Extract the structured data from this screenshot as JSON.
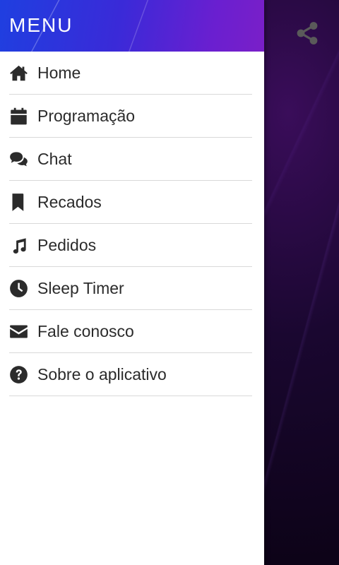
{
  "drawer": {
    "title": "MENU",
    "items": [
      {
        "label": "Home",
        "icon": "home-icon"
      },
      {
        "label": "Programação",
        "icon": "calendar-icon"
      },
      {
        "label": "Chat",
        "icon": "chat-icon"
      },
      {
        "label": "Recados",
        "icon": "bookmark-icon"
      },
      {
        "label": "Pedidos",
        "icon": "music-icon"
      },
      {
        "label": "Sleep Timer",
        "icon": "clock-icon"
      },
      {
        "label": "Fale conosco",
        "icon": "envelope-icon"
      },
      {
        "label": "Sobre o aplicativo",
        "icon": "question-circle-icon"
      }
    ]
  },
  "toolbar": {
    "share_icon": "share-icon"
  },
  "colors": {
    "header_gradient_start": "#1f3fe0",
    "header_gradient_end": "#7a1fc8",
    "menu_text": "#2b2b2b",
    "divider": "#d9d9d9",
    "background_dark": "#14061f",
    "share_icon": "#5a5a5a"
  }
}
